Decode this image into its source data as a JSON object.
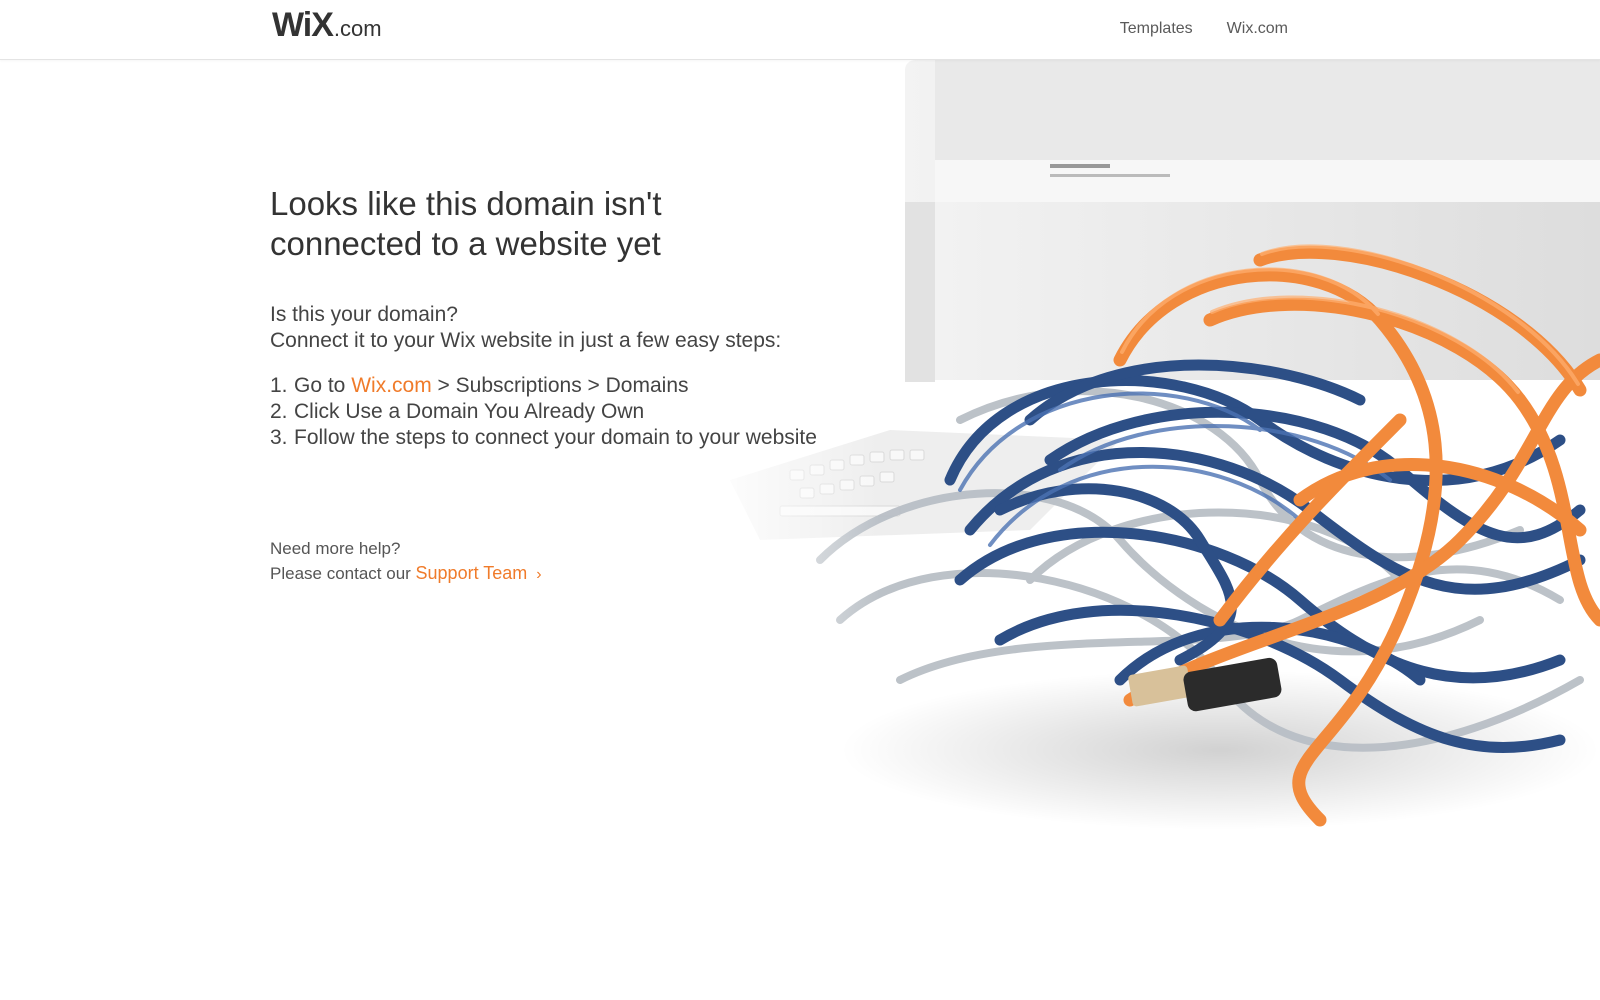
{
  "header": {
    "logo_main": "WiX",
    "logo_suffix": ".com",
    "nav": [
      {
        "label": "Templates"
      },
      {
        "label": "Wix.com"
      }
    ]
  },
  "main": {
    "headline_line1": "Looks like this domain isn't",
    "headline_line2": "connected to a website yet",
    "question": "Is this your domain?",
    "intro": "Connect it to your Wix website in just a few easy steps:",
    "steps": [
      {
        "num": "1.",
        "prefix": "Go to ",
        "link": "Wix.com",
        "suffix": " > Subscriptions > Domains"
      },
      {
        "num": "2.",
        "text": "Click Use a Domain You Already Own"
      },
      {
        "num": "3.",
        "text": "Follow the steps to connect your domain to your website"
      }
    ]
  },
  "help": {
    "title": "Need more help?",
    "prefix": "Please contact our ",
    "link": "Support Team",
    "chevron": "›"
  },
  "colors": {
    "accent": "#f07b2a",
    "text": "#3b3b3b",
    "cable_orange": "#f28a3c",
    "cable_blue": "#2d4f86"
  },
  "icons": [
    "wix-logo",
    "chevron-right-icon"
  ]
}
